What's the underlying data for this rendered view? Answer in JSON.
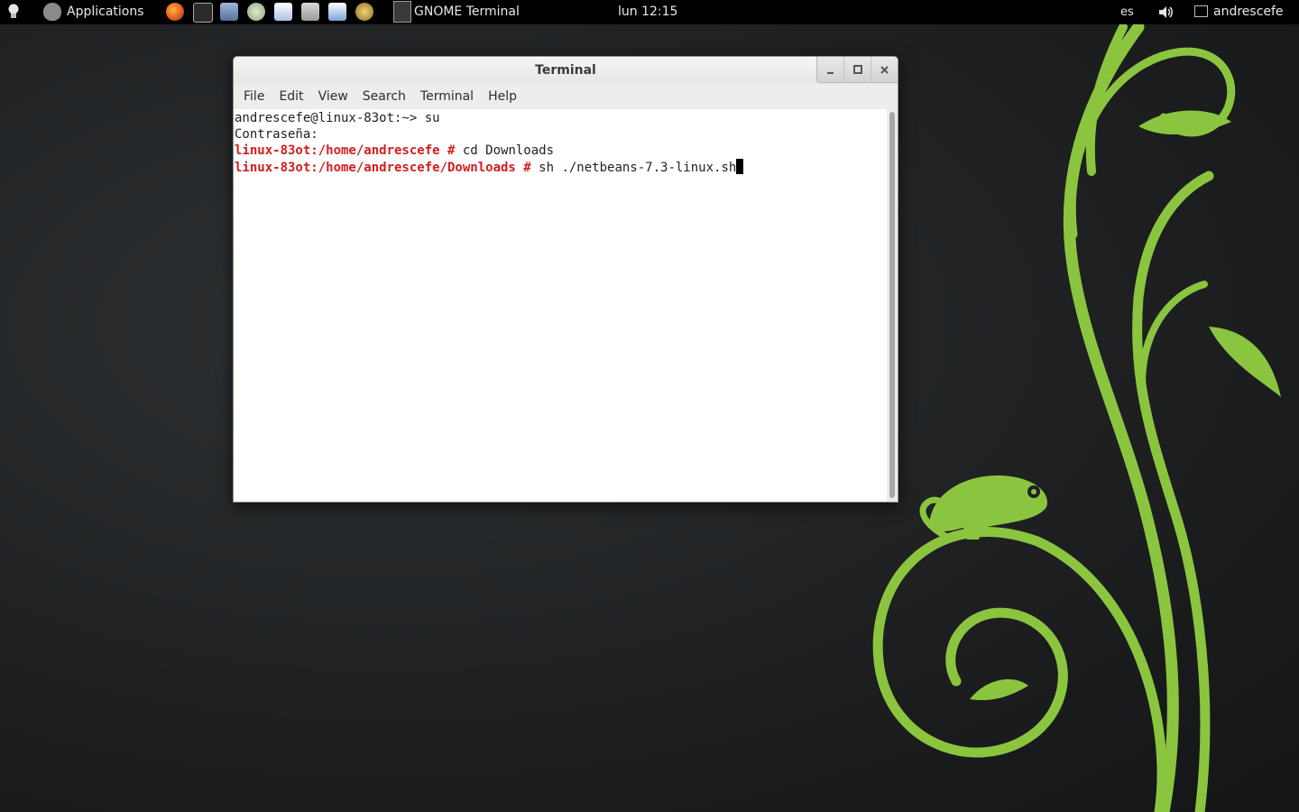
{
  "top_panel": {
    "applications_label": "Applications",
    "active_app_label": "GNOME Terminal",
    "clock": "lun 12:15",
    "keyboard_layout": "es",
    "user_name": "andrescefe",
    "launchers": [
      "firefox-icon",
      "terminal-launcher-icon",
      "package-icon",
      "elephant-icon",
      "document-icon",
      "file-cabinet-icon",
      "chat-icon",
      "media-player-icon"
    ]
  },
  "terminal": {
    "title": "Terminal",
    "menu": [
      "File",
      "Edit",
      "View",
      "Search",
      "Terminal",
      "Help"
    ],
    "lines": [
      {
        "prompt": "",
        "text": "andrescefe@linux-83ot:~> su"
      },
      {
        "prompt": "",
        "text": "Contraseña:"
      },
      {
        "prompt": "linux-83ot:/home/andrescefe #",
        "text": " cd Downloads"
      },
      {
        "prompt": "linux-83ot:/home/andrescefe/Downloads #",
        "text": " sh ./netbeans-7.3-linux.sh"
      }
    ]
  },
  "colors": {
    "accent_green": "#8bc53f",
    "prompt_red": "#d41e1e",
    "panel_bg": "#000000"
  }
}
